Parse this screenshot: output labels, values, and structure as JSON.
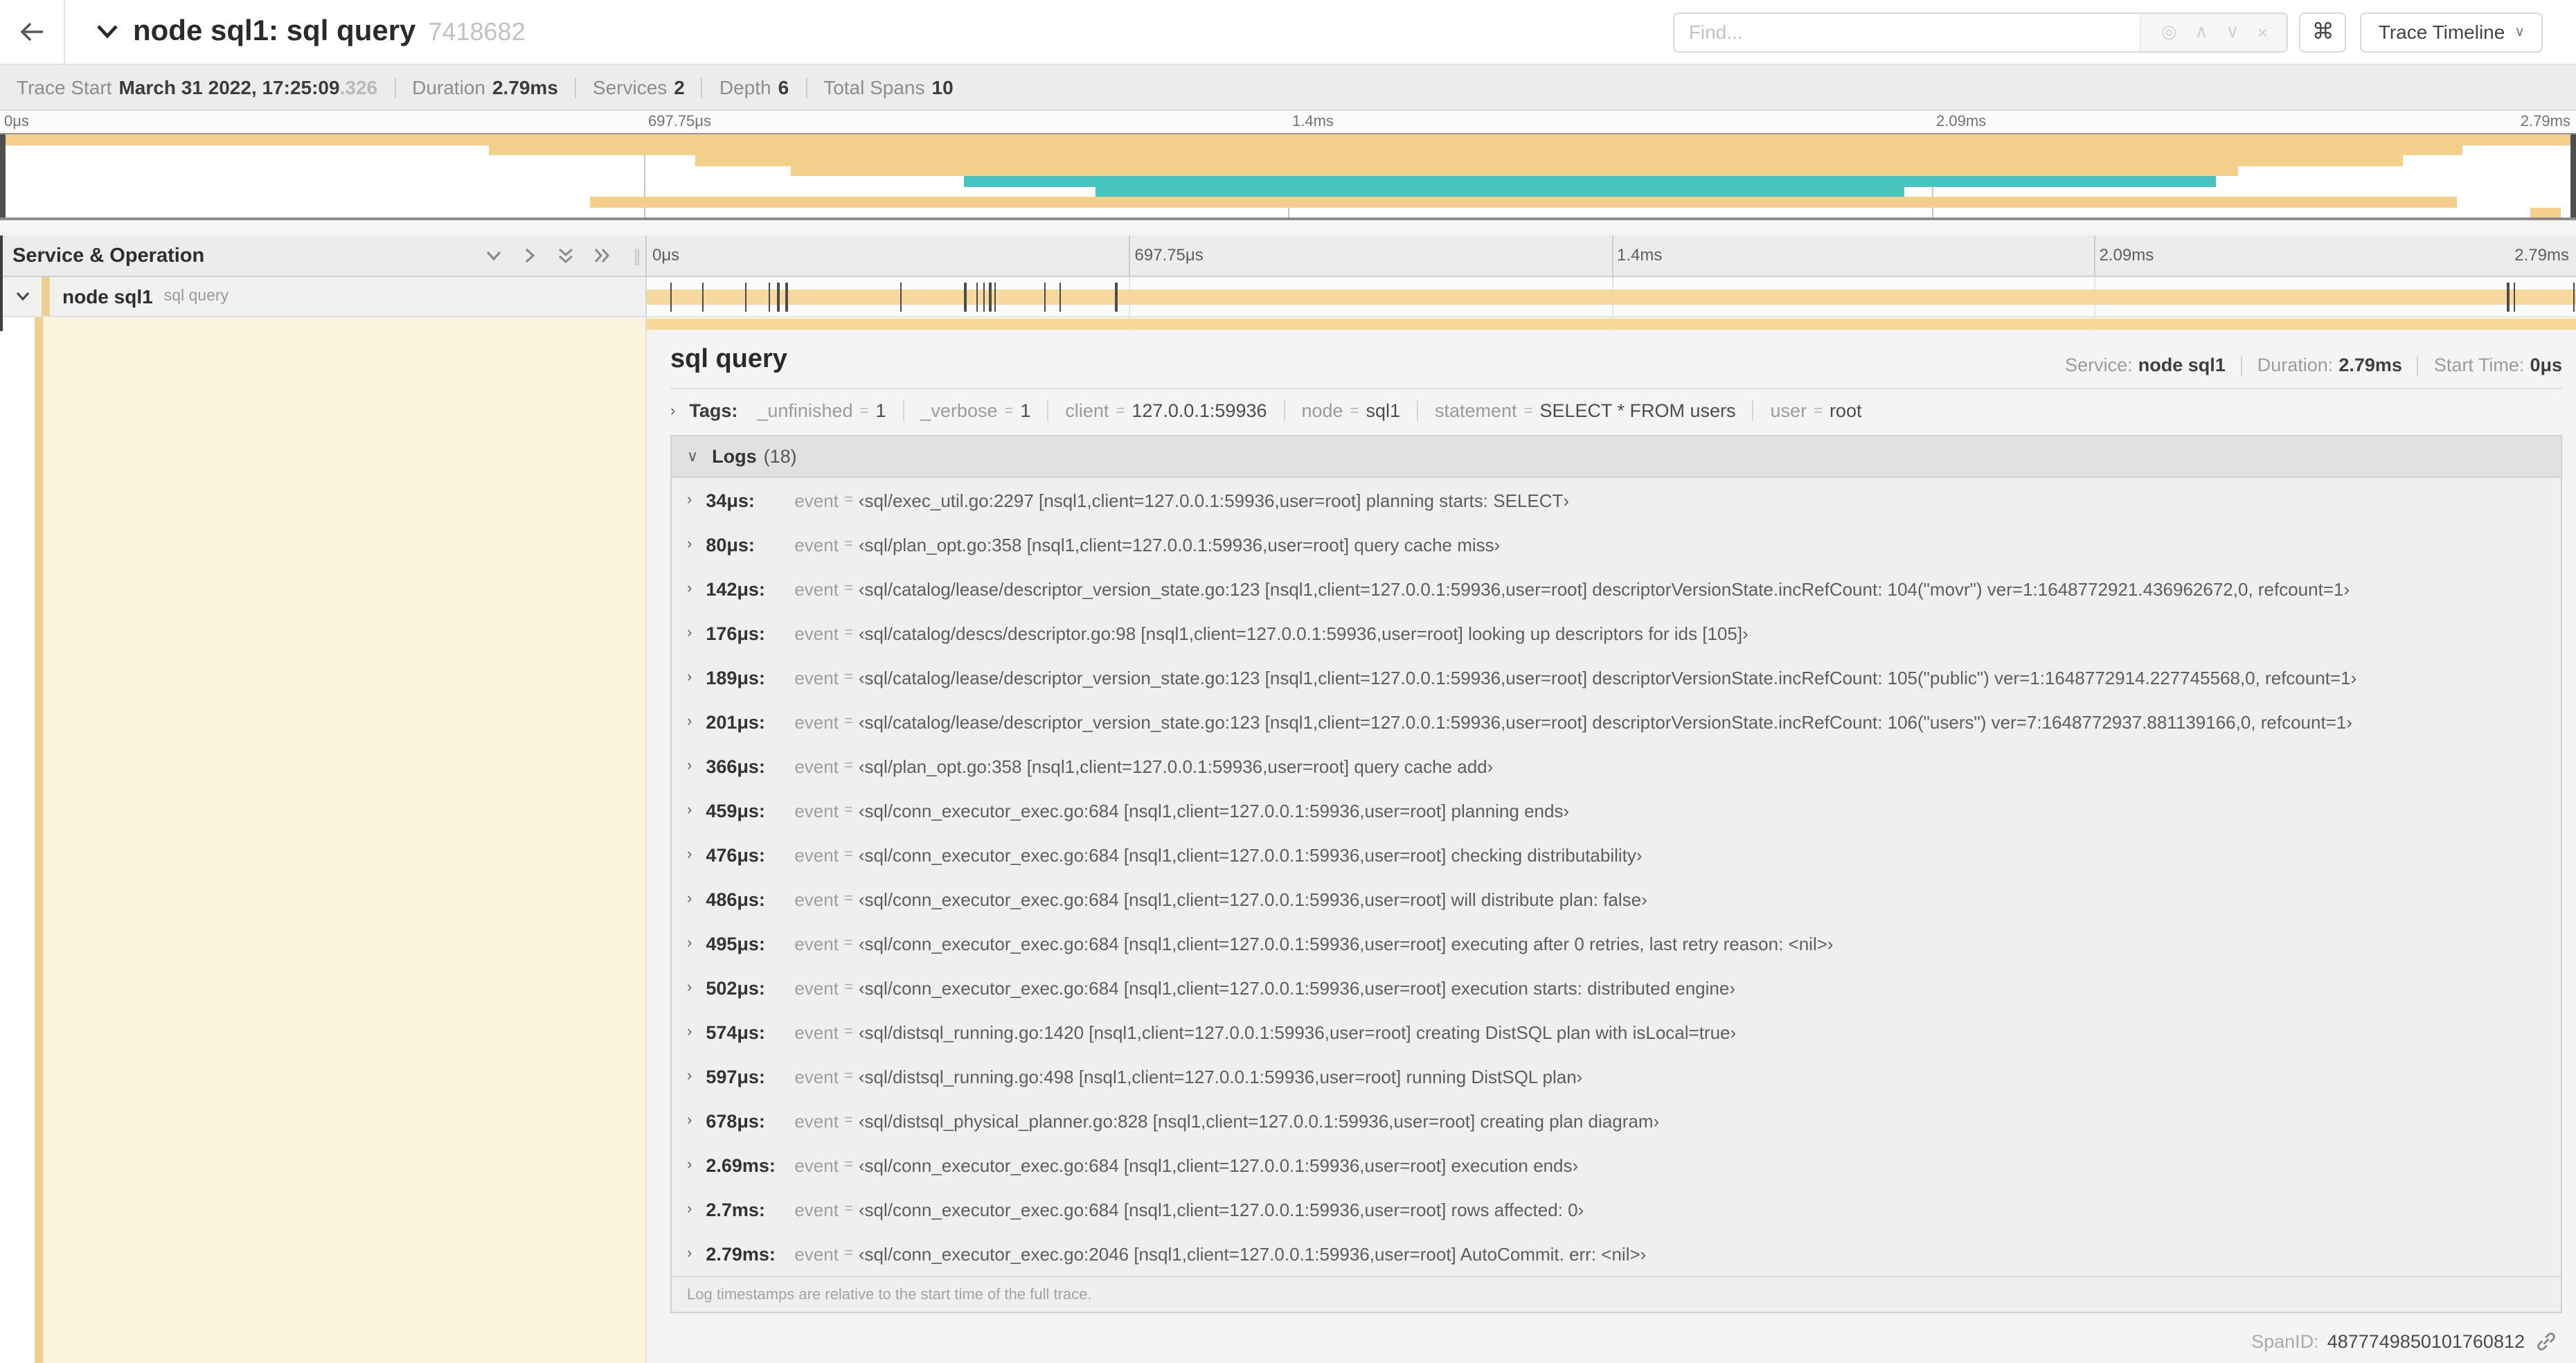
{
  "header": {
    "title": "node sql1: sql query",
    "trace_id": "7418682",
    "find_placeholder": "Find...",
    "find_suffix_icons": [
      "target-icon",
      "chevron-up-icon",
      "chevron-down-icon",
      "close-icon"
    ],
    "keyboard_shortcut_button": "⌘",
    "view_selector_label": "Trace Timeline"
  },
  "trace_info": {
    "trace_start_label": "Trace Start",
    "trace_start_value": "March 31 2022, 17:25:09",
    "trace_start_fraction": ".326",
    "duration_label": "Duration",
    "duration_value": "2.79ms",
    "services_label": "Services",
    "services_value": "2",
    "depth_label": "Depth",
    "depth_value": "6",
    "total_spans_label": "Total Spans",
    "total_spans_value": "10"
  },
  "timeline": {
    "ticks": [
      {
        "label": "0μs",
        "left": "0%"
      },
      {
        "label": "697.75μs",
        "left": "25%"
      },
      {
        "label": "1.4ms",
        "left": "50%"
      },
      {
        "label": "2.09ms",
        "left": "75%"
      },
      {
        "label": "2.79ms",
        "left": "100%"
      }
    ],
    "colors": {
      "span_tan": "#f7d99d",
      "span_teal": "#47c4bf"
    },
    "minimap_rows": [
      {
        "left": "0%",
        "width": "100%",
        "color": "#f3cf8b"
      },
      {
        "left": "19%",
        "width": "76.6%",
        "color": "#f3cf8b"
      },
      {
        "left": "27%",
        "width": "66.3%",
        "color": "#f3cf8b"
      },
      {
        "left": "30.7%",
        "width": "56.2%",
        "color": "#f3cf8b"
      },
      {
        "left": "37.4%",
        "width": "48.6%",
        "color": "#47c4bf"
      },
      {
        "left": "42.5%",
        "width": "31.4%",
        "color": "#47c4bf"
      },
      {
        "left": "22.9%",
        "width": "72.5%",
        "color": "#f3cf8b"
      },
      {
        "left": "98.2%",
        "width": "1.2%",
        "color": "#f3cf8b"
      }
    ]
  },
  "span_table": {
    "header_label": "Service & Operation",
    "row": {
      "service": "node sql1",
      "operation": "sql query"
    },
    "log_ticks": [
      {
        "left": "1.22%"
      },
      {
        "left": "2.87%"
      },
      {
        "left": "5.09%"
      },
      {
        "left": "6.31%"
      },
      {
        "left": "6.77%"
      },
      {
        "left": "7.2%"
      },
      {
        "left": "13.12%"
      },
      {
        "left": "16.45%"
      },
      {
        "left": "17.06%"
      },
      {
        "left": "17.42%"
      },
      {
        "left": "17.74%"
      },
      {
        "left": "17.99%"
      },
      {
        "left": "20.57%"
      },
      {
        "left": "21.4%"
      },
      {
        "left": "24.3%"
      },
      {
        "left": "96.42%"
      },
      {
        "left": "96.77%"
      },
      {
        "left": "99.85%"
      }
    ]
  },
  "detail": {
    "title": "sql query",
    "service_label": "Service:",
    "service_value": "node sql1",
    "duration_label": "Duration:",
    "duration_value": "2.79ms",
    "start_time_label": "Start Time:",
    "start_time_value": "0μs",
    "tags_label": "Tags:",
    "tags": [
      {
        "key": "_unfinished",
        "value": "1"
      },
      {
        "key": "_verbose",
        "value": "1"
      },
      {
        "key": "client",
        "value": "127.0.0.1:59936"
      },
      {
        "key": "node",
        "value": "sql1"
      },
      {
        "key": "statement",
        "value": "SELECT * FROM users"
      },
      {
        "key": "user",
        "value": "root"
      }
    ],
    "logs_label": "Logs",
    "logs_count": "(18)",
    "logs": [
      {
        "time": "34μs:",
        "field": "event",
        "eq": "=",
        "value": "‹sql/exec_util.go:2297 [nsql1,client=127.0.0.1:59936,user=root] planning starts: SELECT›"
      },
      {
        "time": "80μs:",
        "field": "event",
        "eq": "=",
        "value": "‹sql/plan_opt.go:358 [nsql1,client=127.0.0.1:59936,user=root] query cache miss›"
      },
      {
        "time": "142μs:",
        "field": "event",
        "eq": "=",
        "value": "‹sql/catalog/lease/descriptor_version_state.go:123 [nsql1,client=127.0.0.1:59936,user=root] descriptorVersionState.incRefCount: 104(\"movr\") ver=1:1648772921.436962672,0, refcount=1›"
      },
      {
        "time": "176μs:",
        "field": "event",
        "eq": "=",
        "value": "‹sql/catalog/descs/descriptor.go:98 [nsql1,client=127.0.0.1:59936,user=root] looking up descriptors for ids [105]›"
      },
      {
        "time": "189μs:",
        "field": "event",
        "eq": "=",
        "value": "‹sql/catalog/lease/descriptor_version_state.go:123 [nsql1,client=127.0.0.1:59936,user=root] descriptorVersionState.incRefCount: 105(\"public\") ver=1:1648772914.227745568,0, refcount=1›"
      },
      {
        "time": "201μs:",
        "field": "event",
        "eq": "=",
        "value": "‹sql/catalog/lease/descriptor_version_state.go:123 [nsql1,client=127.0.0.1:59936,user=root] descriptorVersionState.incRefCount: 106(\"users\") ver=7:1648772937.881139166,0, refcount=1›"
      },
      {
        "time": "366μs:",
        "field": "event",
        "eq": "=",
        "value": "‹sql/plan_opt.go:358 [nsql1,client=127.0.0.1:59936,user=root] query cache add›"
      },
      {
        "time": "459μs:",
        "field": "event",
        "eq": "=",
        "value": "‹sql/conn_executor_exec.go:684 [nsql1,client=127.0.0.1:59936,user=root] planning ends›"
      },
      {
        "time": "476μs:",
        "field": "event",
        "eq": "=",
        "value": "‹sql/conn_executor_exec.go:684 [nsql1,client=127.0.0.1:59936,user=root] checking distributability›"
      },
      {
        "time": "486μs:",
        "field": "event",
        "eq": "=",
        "value": "‹sql/conn_executor_exec.go:684 [nsql1,client=127.0.0.1:59936,user=root] will distribute plan: false›"
      },
      {
        "time": "495μs:",
        "field": "event",
        "eq": "=",
        "value": "‹sql/conn_executor_exec.go:684 [nsql1,client=127.0.0.1:59936,user=root] executing after 0 retries, last retry reason: <nil>›"
      },
      {
        "time": "502μs:",
        "field": "event",
        "eq": "=",
        "value": "‹sql/conn_executor_exec.go:684 [nsql1,client=127.0.0.1:59936,user=root] execution starts: distributed engine›"
      },
      {
        "time": "574μs:",
        "field": "event",
        "eq": "=",
        "value": "‹sql/distsql_running.go:1420 [nsql1,client=127.0.0.1:59936,user=root] creating DistSQL plan with isLocal=true›"
      },
      {
        "time": "597μs:",
        "field": "event",
        "eq": "=",
        "value": "‹sql/distsql_running.go:498 [nsql1,client=127.0.0.1:59936,user=root] running DistSQL plan›"
      },
      {
        "time": "678μs:",
        "field": "event",
        "eq": "=",
        "value": "‹sql/distsql_physical_planner.go:828 [nsql1,client=127.0.0.1:59936,user=root] creating plan diagram›"
      },
      {
        "time": "2.69ms:",
        "field": "event",
        "eq": "=",
        "value": "‹sql/conn_executor_exec.go:684 [nsql1,client=127.0.0.1:59936,user=root] execution ends›"
      },
      {
        "time": "2.7ms:",
        "field": "event",
        "eq": "=",
        "value": "‹sql/conn_executor_exec.go:684 [nsql1,client=127.0.0.1:59936,user=root] rows affected: 0›"
      },
      {
        "time": "2.79ms:",
        "field": "event",
        "eq": "=",
        "value": "‹sql/conn_executor_exec.go:2046 [nsql1,client=127.0.0.1:59936,user=root] AutoCommit. err: <nil>›"
      }
    ],
    "logs_note": "Log timestamps are relative to the start time of the full trace.",
    "spanid_label": "SpanID:",
    "spanid_value": "4877749850101760812"
  }
}
